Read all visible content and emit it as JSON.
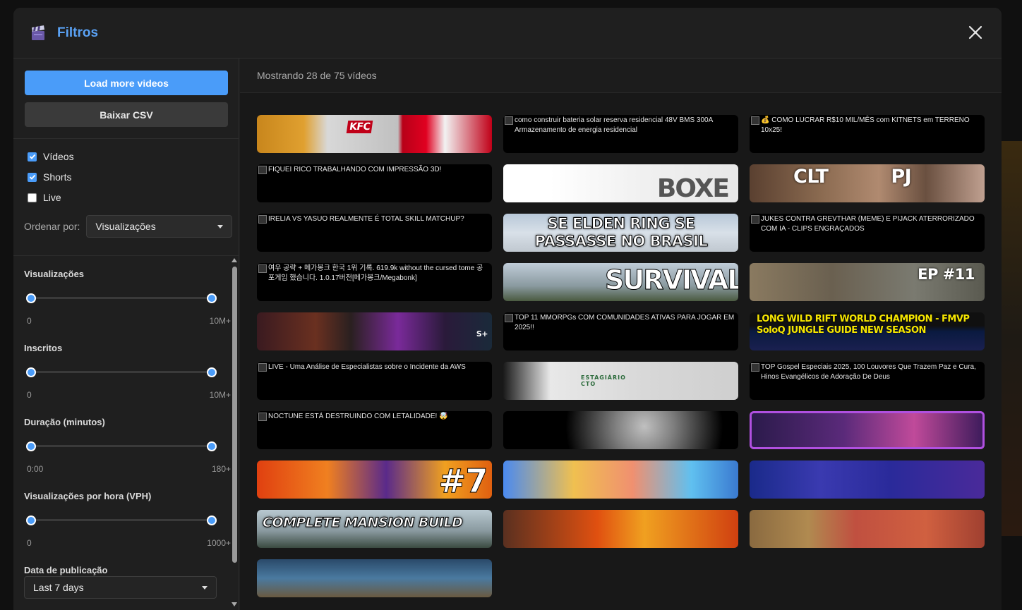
{
  "header": {
    "title": "Filtros"
  },
  "sidebar": {
    "load_more_label": "Load more videos",
    "csv_label": "Baixar CSV",
    "checkboxes": [
      {
        "label": "Vídeos",
        "checked": true
      },
      {
        "label": "Shorts",
        "checked": true
      },
      {
        "label": "Live",
        "checked": false
      }
    ],
    "sort": {
      "label": "Ordenar por:",
      "value": "Visualizações"
    },
    "filters": [
      {
        "label": "Visualizações",
        "min": "0",
        "max": "10M+",
        "range_fraction": [
          0,
          1
        ]
      },
      {
        "label": "Inscritos",
        "min": "0",
        "max": "10M+",
        "range_fraction": [
          0,
          1
        ]
      },
      {
        "label": "Duração (minutos)",
        "min": "0:00",
        "max": "180+",
        "range_fraction": [
          0,
          1
        ]
      },
      {
        "label": "Visualizações por hora (VPH)",
        "min": "0",
        "max": "1000+",
        "range_fraction": [
          0,
          1
        ]
      }
    ],
    "date": {
      "label": "Data de publicação",
      "value": "Last 7 days"
    }
  },
  "main": {
    "status": "Mostrando 28 de 75 vídeos",
    "videos": [
      {
        "type": "thumb",
        "text": "KFC",
        "style": "kfc"
      },
      {
        "type": "alt",
        "text": "como construir bateria solar reserva residencial 48V BMS 300A Armazenamento de energia residencial"
      },
      {
        "type": "alt",
        "text": "💰 COMO LUCRAR R$10 MIL/MÊS com KITNETS em TERRENO 10x25!"
      },
      {
        "type": "alt",
        "text": "FIQUEI RICO TRABALHANDO COM IMPRESSÃO 3D!"
      },
      {
        "type": "thumb",
        "text": "BOXE",
        "style": "boxe"
      },
      {
        "type": "thumb",
        "text": "CLT PJ",
        "style": "cltpj"
      },
      {
        "type": "alt",
        "text": "IRELIA VS YASUO REALMENTE É TOTAL SKILL MATCHUP?"
      },
      {
        "type": "thumb",
        "text": "SE ELDEN RING SE PASSASSE NO BRASIL",
        "style": "elden"
      },
      {
        "type": "alt",
        "text": "JUKES CONTRA GREVTHAR (MEME) E PIJACK ATERRORIZADO COM IA - CLIPS ENGRAÇADOS"
      },
      {
        "type": "alt",
        "text": "여우 공략 + 메가봉크 한국 1위 기록. 619.9k without the cursed tome 공포게임 했습니다. 1.0.17버전[메가봉크/Megabonk]"
      },
      {
        "type": "thumb",
        "text": "SURVIVAL",
        "style": "survival"
      },
      {
        "type": "thumb",
        "text": "EP #11",
        "style": "ep11"
      },
      {
        "type": "thumb",
        "text": "S+",
        "style": "rank"
      },
      {
        "type": "alt",
        "text": "TOP 11 MMORPGs COM COMUNIDADES ATIVAS PARA JOGAR EM 2025!!"
      },
      {
        "type": "thumb",
        "text": "LONG WILD RIFT WORLD CHAMPION - FMVP SoloQ JUNGLE GUIDE NEW SEASON",
        "style": "wildrift"
      },
      {
        "type": "alt",
        "text": "LIVE - Uma Análise de Especialistas sobre o Incidente da AWS"
      },
      {
        "type": "thumb",
        "text": "ESTAGIÁRIO CTO",
        "style": "estagio"
      },
      {
        "type": "alt",
        "text": "TOP Gospel Especiais 2025, 100 Louvores Que Trazem Paz e Cura, Hinos Evangélicos de Adoração De Deus"
      },
      {
        "type": "alt",
        "text": "NOCTUNE ESTÁ DESTRUINDO COM LETALIDADE! 🤯"
      },
      {
        "type": "thumb",
        "text": "",
        "style": "robot"
      },
      {
        "type": "thumb",
        "text": "",
        "style": "ahri"
      },
      {
        "type": "thumb",
        "text": "#7",
        "style": "hash7"
      },
      {
        "type": "thumb",
        "text": "",
        "style": "cartoon"
      },
      {
        "type": "thumb",
        "text": "",
        "style": "team"
      },
      {
        "type": "thumb",
        "text": "COMPLETE MANSION BUILD",
        "style": "mansion"
      },
      {
        "type": "thumb",
        "text": "",
        "style": "fire"
      },
      {
        "type": "thumb",
        "text": "",
        "style": "crowd"
      },
      {
        "type": "thumb",
        "text": "",
        "style": "storm"
      }
    ]
  }
}
